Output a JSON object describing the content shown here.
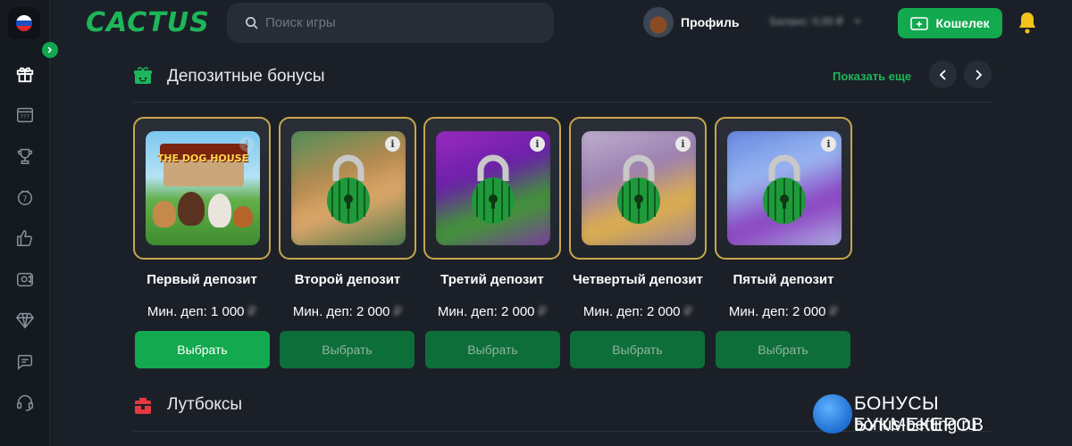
{
  "header": {
    "logo": "CACTUS",
    "search_placeholder": "Поиск игры",
    "profile_label": "Профиль",
    "balance_text": "Баланс: 0,00 ₽",
    "wallet_label": "Кошелек"
  },
  "sidebar": {
    "items": [
      {
        "icon": "gift-icon"
      },
      {
        "icon": "slot-machine-icon"
      },
      {
        "icon": "trophy-icon"
      },
      {
        "icon": "lottery-ball-icon"
      },
      {
        "icon": "thumbs-up-icon"
      },
      {
        "icon": "live-camera-icon"
      },
      {
        "icon": "diamond-icon"
      },
      {
        "icon": "chat-icon"
      },
      {
        "icon": "support-headset-icon"
      }
    ]
  },
  "deposit_section": {
    "title": "Депозитные бонусы",
    "show_more": "Показать еще",
    "cards": [
      {
        "title": "Первый депозит",
        "min_deposit": "Мин. деп: 1 000",
        "currency": "₽",
        "button": "Выбрать",
        "locked": false,
        "image_label": "THE DOG HOUSE"
      },
      {
        "title": "Второй депозит",
        "min_deposit": "Мин. деп: 2 000",
        "currency": "₽",
        "button": "Выбрать",
        "locked": true
      },
      {
        "title": "Третий депозит",
        "min_deposit": "Мин. деп: 2 000",
        "currency": "₽",
        "button": "Выбрать",
        "locked": true
      },
      {
        "title": "Четвертый депозит",
        "min_deposit": "Мин. деп: 2 000",
        "currency": "₽",
        "button": "Выбрать",
        "locked": true
      },
      {
        "title": "Пятый депозит",
        "min_deposit": "Мин. деп: 2 000",
        "currency": "₽",
        "button": "Выбрать",
        "locked": true
      }
    ]
  },
  "lootbox_section": {
    "title": "Лутбоксы"
  },
  "watermark": {
    "line1": "БОНУСЫ БУКМЕКЕРОВ",
    "line2": "bonus-betting.ru"
  },
  "colors": {
    "accent": "#12a94f",
    "background": "#1b2028",
    "card_border": "#c8a64a"
  }
}
